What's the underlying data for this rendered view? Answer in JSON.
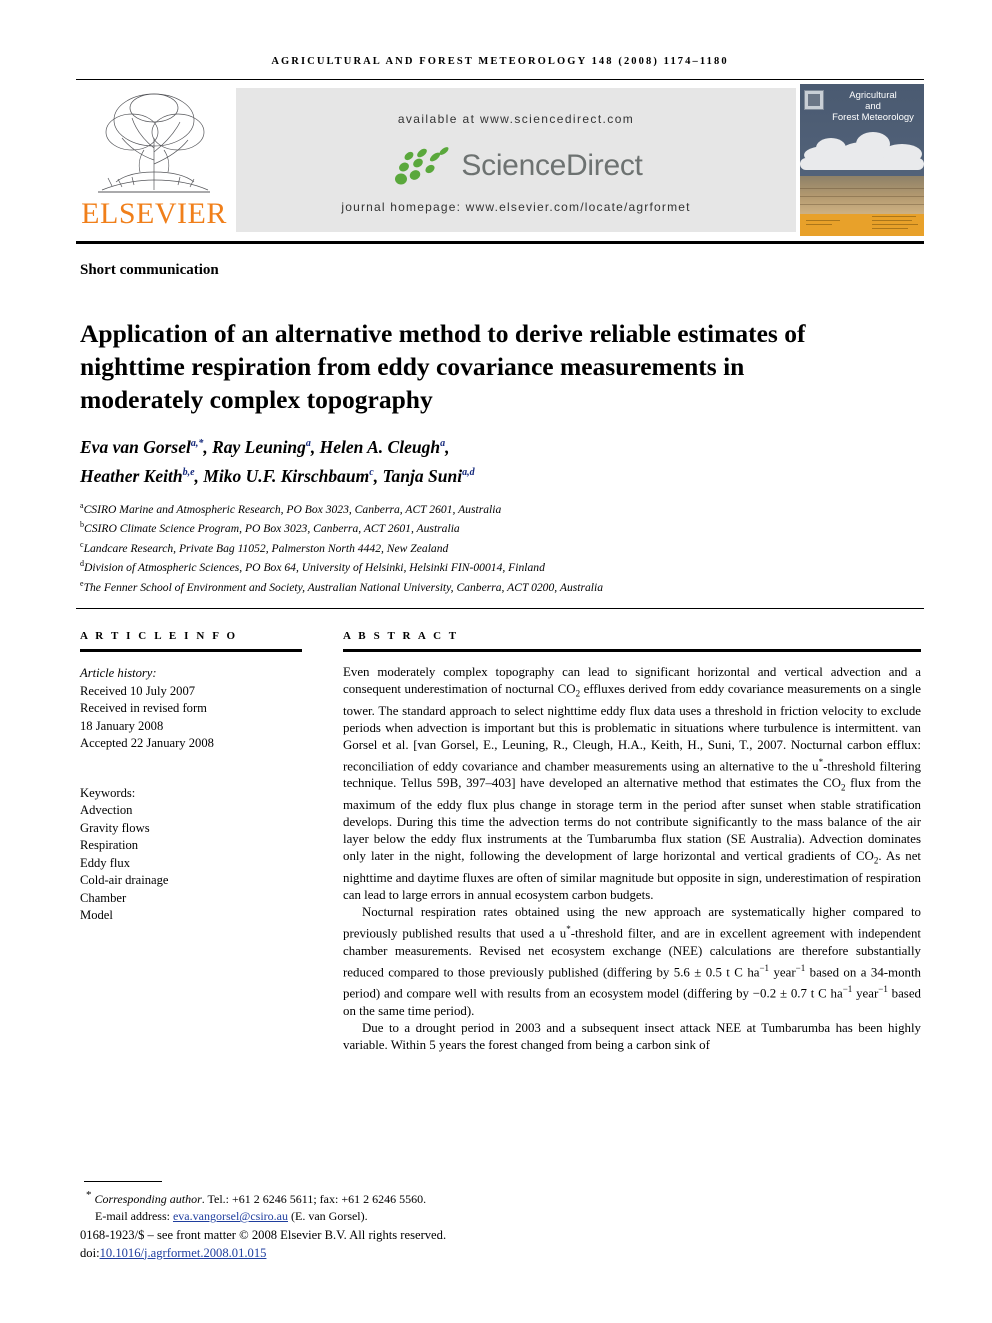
{
  "running_head": "AGRICULTURAL AND FOREST METEOROLOGY 148 (2008) 1174–1180",
  "masthead": {
    "available_at": "available at www.sciencedirect.com",
    "sciencedirect_label": "ScienceDirect",
    "journal_homepage": "journal homepage: www.elsevier.com/locate/agrformet",
    "publisher": "ELSEVIER",
    "cover_title_line1": "Agricultural",
    "cover_title_line2": "and",
    "cover_title_line3": "Forest Meteorology",
    "colors": {
      "elsevier_orange": "#F07F1A",
      "sciencedirect_green": "#5aa83c",
      "sciencedirect_gray": "#6d7271",
      "panel_gray": "#e6e6e6",
      "cover_sky": "#4b5b72",
      "cover_orange": "#e8a12a"
    }
  },
  "article": {
    "type_label": "Short communication",
    "title": "Application of an alternative method to derive reliable estimates of nighttime respiration from eddy covariance measurements in moderately complex topography",
    "authors": [
      {
        "name": "Eva van Gorsel",
        "marks": "a,*"
      },
      {
        "name": "Ray Leuning",
        "marks": "a"
      },
      {
        "name": "Helen A. Cleugh",
        "marks": "a"
      },
      {
        "name": "Heather Keith",
        "marks": "b,e"
      },
      {
        "name": "Miko U.F. Kirschbaum",
        "marks": "c"
      },
      {
        "name": "Tanja Suni",
        "marks": "a,d"
      }
    ],
    "affiliations": [
      {
        "mark": "a",
        "text": "CSIRO Marine and Atmospheric Research, PO Box 3023, Canberra, ACT 2601, Australia"
      },
      {
        "mark": "b",
        "text": "CSIRO Climate Science Program, PO Box 3023, Canberra, ACT 2601, Australia"
      },
      {
        "mark": "c",
        "text": "Landcare Research, Private Bag 11052, Palmerston North 4442, New Zealand"
      },
      {
        "mark": "d",
        "text": "Division of Atmospheric Sciences, PO Box 64, University of Helsinki, Helsinki FIN-00014, Finland"
      },
      {
        "mark": "e",
        "text": "The Fenner School of Environment and Society, Australian National University, Canberra, ACT 0200, Australia"
      }
    ]
  },
  "info": {
    "heading": "A R T I C L E   I N F O",
    "history_label": "Article history:",
    "history": [
      "Received 10 July 2007",
      "Received in revised form",
      "18 January 2008",
      "Accepted 22 January 2008"
    ],
    "keywords_label": "Keywords:",
    "keywords": [
      "Advection",
      "Gravity flows",
      "Respiration",
      "Eddy flux",
      "Cold-air drainage",
      "Chamber",
      "Model"
    ]
  },
  "abstract": {
    "heading": "A B S T R A C T",
    "paragraph_1_a": "Even moderately complex topography can lead to significant horizontal and vertical advection and a consequent underestimation of nocturnal CO",
    "paragraph_1_b": "2",
    "paragraph_1_c": " effluxes derived from eddy covariance measurements on a single tower. The standard approach to select nighttime eddy flux data uses a threshold in friction velocity to exclude periods when advection is important but this is problematic in situations where turbulence is intermittent. van Gorsel et al. [van Gorsel, E., Leuning, R., Cleugh, H.A., Keith, H., Suni, T., 2007. Nocturnal carbon efflux: reconciliation of eddy covariance and chamber measurements using an alternative to the u",
    "paragraph_1_d": "*",
    "paragraph_1_e": "-threshold filtering technique. Tellus 59B, 397–403] have developed an alternative method that estimates the CO",
    "paragraph_1_f": "2",
    "paragraph_1_g": " flux from the maximum of the eddy flux plus change in storage term in the period after sunset when stable stratification develops. During this time the advection terms do not contribute significantly to the mass balance of the air layer below the eddy flux instruments at the Tumbarumba flux station (SE Australia). Advection dominates only later in the night, following the development of large horizontal and vertical gradients of CO",
    "paragraph_1_h": "2",
    "paragraph_1_i": ". As net nighttime and daytime fluxes are often of similar magnitude but opposite in sign, underestimation of respiration can lead to large errors in annual ecosystem carbon budgets.",
    "paragraph_2_a": "Nocturnal respiration rates obtained using the new approach are systematically higher compared to previously published results that used a u",
    "paragraph_2_b": "*",
    "paragraph_2_c": "-threshold filter, and are in excellent agreement with independent chamber measurements. Revised net ecosystem exchange (NEE) calculations are therefore substantially reduced compared to those previously published (differing by 5.6 ± 0.5 t C ha",
    "paragraph_2_d": "−1",
    "paragraph_2_e": " year",
    "paragraph_2_f": "−1",
    "paragraph_2_g": " based on a 34-month period) and compare well with results from an ecosystem model (differing by −0.2 ± 0.7 t C ha",
    "paragraph_2_h": "−1",
    "paragraph_2_i": " year",
    "paragraph_2_j": "−1",
    "paragraph_2_k": " based on the same time period).",
    "paragraph_3": "Due to a drought period in 2003 and a subsequent insect attack NEE at Tumbarumba has been highly variable. Within 5 years the forest changed from being a carbon sink of"
  },
  "footer": {
    "corresponding_label": "Corresponding author",
    "corresponding_contact": ". Tel.: +61 2 6246 5611; fax: +61 2 6246 5560.",
    "email_label": "E-mail address:",
    "email": "eva.vangorsel@csiro.au",
    "email_owner": "(E. van Gorsel).",
    "issn_line": "0168-1923/$ – see front matter © 2008 Elsevier B.V. All rights reserved.",
    "doi_label": "doi:",
    "doi": "10.1016/j.agrformet.2008.01.015"
  }
}
